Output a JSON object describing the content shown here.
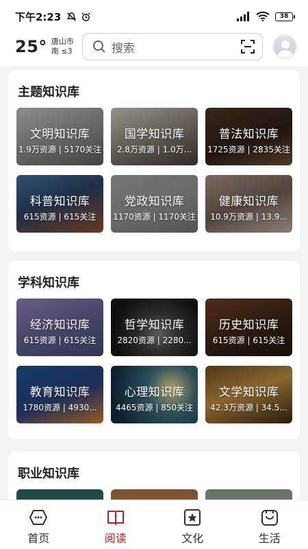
{
  "status": {
    "time": "下午2:23",
    "battery": "38"
  },
  "header": {
    "temperature": "25°",
    "city": "唐山市",
    "wind": "南 ≤3",
    "search_placeholder": "搜索"
  },
  "sections": [
    {
      "title": "主题知识库",
      "cards": [
        {
          "name": "文明知识库",
          "stats": "1.9万资源 | 5170关注",
          "bg": "linear-gradient(160deg,#bdbdbd 0%,#8a8a8a 50%,#5a5a5a 100%)"
        },
        {
          "name": "国学知识库",
          "stats": "2.8万资源 | 1.0万...",
          "bg": "linear-gradient(160deg,#c8c2b8 0%,#7d756a 55%,#3e3a35 100%)"
        },
        {
          "name": "普法知识库",
          "stats": "1725资源 | 2835关注",
          "bg": "linear-gradient(160deg,#4a3426 0%,#2a1d16 55%,#6b4a33 100%)"
        },
        {
          "name": "科普知识库",
          "stats": "615资源 | 615关注",
          "bg": "linear-gradient(160deg,#3b6f9c 0%,#2b3f5e 45%,#8a4a2f 100%)"
        },
        {
          "name": "党政知识库",
          "stats": "1170资源 | 1170关注",
          "bg": "linear-gradient(160deg,#9d9d9d 0%,#8c8c8c 55%,#6f6f6f 100%)"
        },
        {
          "name": "健康知识库",
          "stats": "10.9万资源 | 13.9...",
          "bg": "linear-gradient(160deg,#a48d80 0%,#6d5a52 50%,#b9a89c 100%)"
        }
      ]
    },
    {
      "title": "学科知识库",
      "cards": [
        {
          "name": "经济知识库",
          "stats": "615资源 | 615关注",
          "bg": "linear-gradient(160deg,#8e7bb4 0%,#5d5d8d 50%,#3f4a6e 100%)"
        },
        {
          "name": "哲学知识库",
          "stats": "2820资源 | 2280...",
          "bg": "radial-gradient(circle at 55% 60%,#7a7a7a 0%,#3a3a3a 35%,#151515 75%)"
        },
        {
          "name": "历史知识库",
          "stats": "615资源 | 615关注",
          "bg": "linear-gradient(160deg,#6a3b24 0%,#3a2216 55%,#1e120c 100%)"
        },
        {
          "name": "教育知识库",
          "stats": "1780资源 | 4930...",
          "bg": "linear-gradient(160deg,#1b4f8e 0%,#2b3e75 55%,#c77a2e 100%)"
        },
        {
          "name": "心理知识库",
          "stats": "4465资源 | 850关注",
          "bg": "radial-gradient(circle at 70% 40%,#e6d38a 0%,#3b6a7a 35%,#112a3d 85%)"
        },
        {
          "name": "文学知识库",
          "stats": "42.3万资源 | 34.5...",
          "bg": "linear-gradient(160deg,#6b4a20 0%,#b8873f 45%,#3a2612 100%)"
        }
      ]
    },
    {
      "title": "职业知识库",
      "cards": [
        {
          "name": "",
          "stats": "",
          "bg": "linear-gradient(180deg,#1f4a44 0%,#2f5d55 100%)"
        },
        {
          "name": "",
          "stats": "",
          "bg": "linear-gradient(180deg,#7a5030 0%,#a7773f 100%)"
        },
        {
          "name": "",
          "stats": "",
          "bg": "linear-gradient(180deg,#6a6f6a 0%,#8b8f88 100%)"
        }
      ]
    }
  ],
  "nav": [
    {
      "label": "首页",
      "icon": "home-icon"
    },
    {
      "label": "阅读",
      "icon": "book-icon"
    },
    {
      "label": "文化",
      "icon": "star-icon"
    },
    {
      "label": "生活",
      "icon": "smile-bag-icon"
    }
  ],
  "colors": {
    "accent": "#b3242a",
    "background": "#f3f3f3"
  }
}
